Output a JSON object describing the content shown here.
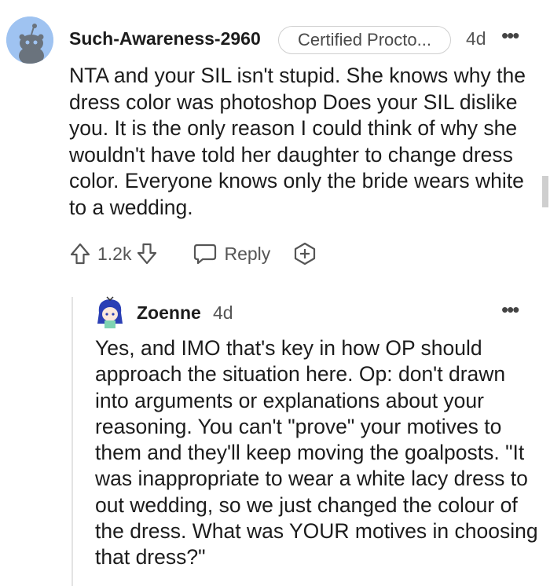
{
  "comment": {
    "username": "Such-Awareness-2960",
    "flair": "Certified Procto...",
    "time": "4d",
    "more": "•••",
    "body": "NTA and your SIL isn't stupid. She knows why the dress color was photoshop Does your SIL dislike you. It is the only reason I could think of why she wouldn't have told her daughter to change dress color. Everyone knows only the bride wears white to a wedding.",
    "votes": "1.2k",
    "reply_label": "Reply"
  },
  "reply": {
    "username": "Zoenne",
    "time": "4d",
    "more": "•••",
    "body": "Yes, and IMO that's key in how OP should approach the situation here. Op: don't drawn into arguments or explanations about your reasoning. You can't \"prove\" your motives to them and they'll keep moving the goalposts. \"It was inappropriate to wear a white lacy dress to out wedding, so we just changed the colour of the dress. What was YOUR motives in choosing that dress?\""
  },
  "colors": {
    "avatar_bg": "#9fc3f1",
    "text": "#1c1c1c",
    "muted": "#555555"
  },
  "icons": [
    "reddit-snoo-avatar",
    "upvote-icon",
    "downvote-icon",
    "reply-icon",
    "award-add-icon",
    "anime-avatar"
  ]
}
